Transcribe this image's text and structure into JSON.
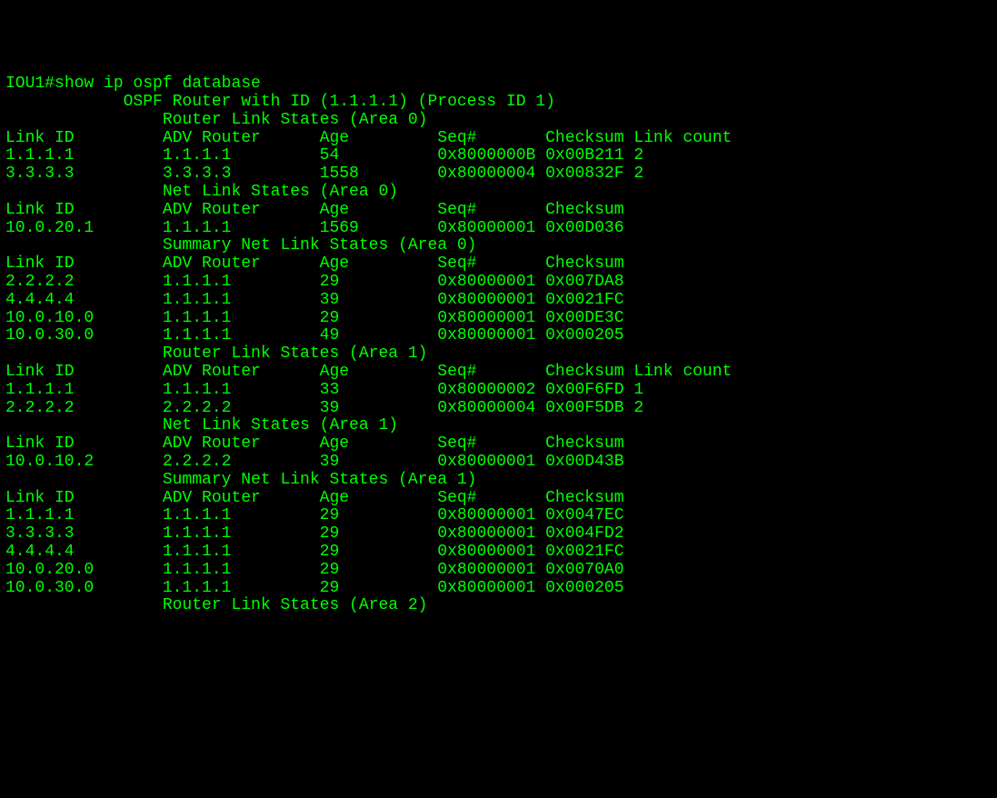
{
  "prompt_prefix": "IOU1#",
  "command": "show ip ospf database",
  "header": "            OSPF Router with ID (1.1.1.1) (Process ID 1)",
  "sections": [
    {
      "title": "                Router Link States (Area 0)",
      "cols": "Link ID         ADV Router      Age         Seq#       Checksum Link count",
      "rows": [
        "1.1.1.1         1.1.1.1         54          0x8000000B 0x00B211 2",
        "3.3.3.3         3.3.3.3         1558        0x80000004 0x00832F 2"
      ]
    },
    {
      "title": "                Net Link States (Area 0)",
      "cols": "Link ID         ADV Router      Age         Seq#       Checksum",
      "rows": [
        "10.0.20.1       1.1.1.1         1569        0x80000001 0x00D036"
      ]
    },
    {
      "title": "                Summary Net Link States (Area 0)",
      "cols": "Link ID         ADV Router      Age         Seq#       Checksum",
      "rows": [
        "2.2.2.2         1.1.1.1         29          0x80000001 0x007DA8",
        "4.4.4.4         1.1.1.1         39          0x80000001 0x0021FC",
        "10.0.10.0       1.1.1.1         29          0x80000001 0x00DE3C",
        "10.0.30.0       1.1.1.1         49          0x80000001 0x000205"
      ]
    },
    {
      "title": "                Router Link States (Area 1)",
      "cols": "Link ID         ADV Router      Age         Seq#       Checksum Link count",
      "rows": [
        "1.1.1.1         1.1.1.1         33          0x80000002 0x00F6FD 1",
        "2.2.2.2         2.2.2.2         39          0x80000004 0x00F5DB 2"
      ]
    },
    {
      "title": "                Net Link States (Area 1)",
      "cols": "Link ID         ADV Router      Age         Seq#       Checksum",
      "rows": [
        "10.0.10.2       2.2.2.2         39          0x80000001 0x00D43B"
      ]
    },
    {
      "title": "                Summary Net Link States (Area 1)",
      "cols": "Link ID         ADV Router      Age         Seq#       Checksum",
      "rows": [
        "1.1.1.1         1.1.1.1         29          0x80000001 0x0047EC",
        "3.3.3.3         1.1.1.1         29          0x80000001 0x004FD2",
        "4.4.4.4         1.1.1.1         29          0x80000001 0x0021FC",
        "10.0.20.0       1.1.1.1         29          0x80000001 0x0070A0",
        "10.0.30.0       1.1.1.1         29          0x80000001 0x000205"
      ]
    },
    {
      "title": "                Router Link States (Area 2)",
      "cols": null,
      "rows": []
    }
  ]
}
